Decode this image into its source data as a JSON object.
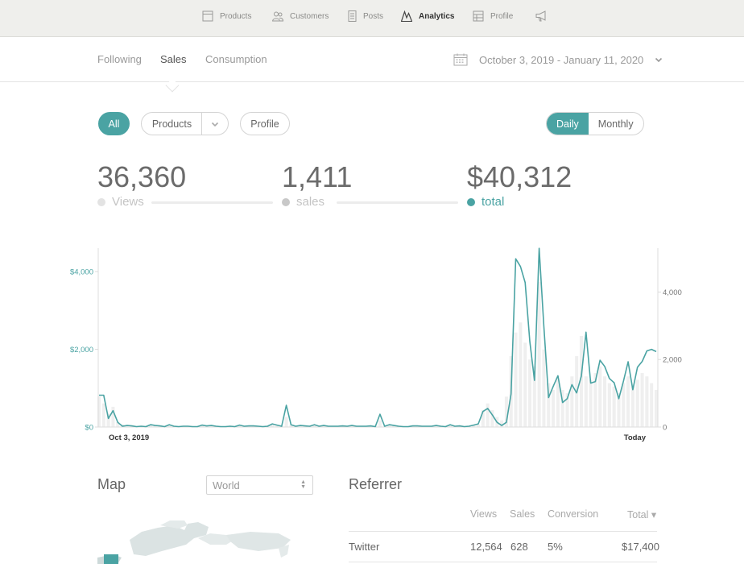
{
  "topnav": {
    "items": [
      {
        "label": "Products",
        "icon": "products-icon",
        "active": false
      },
      {
        "label": "Customers",
        "icon": "customers-icon",
        "active": false
      },
      {
        "label": "Posts",
        "icon": "posts-icon",
        "active": false
      },
      {
        "label": "Analytics",
        "icon": "analytics-icon",
        "active": true
      },
      {
        "label": "Profile",
        "icon": "profile-icon",
        "active": false
      },
      {
        "label": "",
        "icon": "megaphone-icon",
        "active": false
      }
    ]
  },
  "subheader": {
    "tabs": [
      {
        "label": "Following",
        "active": false
      },
      {
        "label": "Sales",
        "active": true
      },
      {
        "label": "Consumption",
        "active": false
      }
    ],
    "date_range": "October 3, 2019 - January 11, 2020"
  },
  "filters": {
    "all_label": "All",
    "products_label": "Products",
    "profile_label": "Profile",
    "granularity": {
      "daily": "Daily",
      "monthly": "Monthly",
      "selected": "Daily"
    }
  },
  "stats": {
    "views": {
      "value": "36,360",
      "label": "Views"
    },
    "sales": {
      "value": "1,411",
      "label": "sales"
    },
    "total": {
      "value": "$40,312",
      "label": "total"
    }
  },
  "colors": {
    "accent": "#4aa3a3",
    "bar_fill": "#efefef",
    "views_dot": "#e3e3e3",
    "sales_dot": "#c8c8c8"
  },
  "chart_data": {
    "type": "line",
    "x_start_label": "Oct 3, 2019",
    "x_end_label": "Today",
    "y_left_ticks": [
      "$0",
      "$2,000",
      "$4,000"
    ],
    "y_left_range": [
      0,
      4500
    ],
    "y_right_ticks": [
      "0",
      "2,000",
      "4,000"
    ],
    "y_right_range": [
      0,
      5300
    ],
    "series": [
      {
        "axis": "left",
        "style": "line",
        "values": [
          820,
          820,
          220,
          420,
          120,
          20,
          40,
          30,
          10,
          20,
          10,
          60,
          40,
          30,
          10,
          60,
          20,
          10,
          20,
          20,
          10,
          10,
          50,
          30,
          40,
          20,
          10,
          10,
          20,
          10,
          50,
          20,
          30,
          30,
          20,
          10,
          20,
          80,
          50,
          20,
          560,
          60,
          20,
          40,
          30,
          20,
          60,
          20,
          40,
          20,
          20,
          20,
          30,
          20,
          40,
          20,
          20,
          20,
          30,
          10,
          330,
          20,
          60,
          40,
          20,
          10,
          10,
          30,
          30,
          20,
          20,
          20,
          40,
          20,
          10,
          60,
          20,
          30,
          10,
          20,
          50,
          80,
          400,
          480,
          310,
          120,
          40,
          120,
          850,
          4330,
          4130,
          3720,
          2200,
          1200,
          4600,
          2600,
          760,
          1050,
          1320,
          630,
          730,
          1090,
          880,
          1310,
          2440,
          1130,
          1170,
          1720,
          1560,
          1250,
          1140,
          730,
          1180,
          1680,
          960,
          1540,
          1690,
          1960,
          2000,
          1940
        ],
        "values_note": ""
      },
      {
        "axis": "right",
        "style": "bar",
        "values": [
          900,
          700,
          400,
          600,
          150,
          80,
          60,
          40,
          20,
          30,
          20,
          50,
          40,
          30,
          20,
          40,
          30,
          20,
          30,
          20,
          20,
          20,
          40,
          30,
          30,
          20,
          20,
          20,
          20,
          20,
          40,
          20,
          30,
          30,
          20,
          20,
          20,
          60,
          40,
          20,
          300,
          60,
          20,
          40,
          30,
          20,
          40,
          20,
          30,
          20,
          20,
          20,
          30,
          20,
          30,
          20,
          20,
          20,
          30,
          20,
          200,
          30,
          50,
          40,
          30,
          20,
          20,
          30,
          30,
          20,
          20,
          20,
          30,
          20,
          20,
          40,
          20,
          30,
          20,
          20,
          50,
          70,
          500,
          700,
          500,
          300,
          200,
          900,
          2100,
          2800,
          3100,
          2500,
          2000,
          1800,
          4300,
          2300,
          1300,
          1100,
          1400,
          1100,
          1000,
          1500,
          2100,
          2700,
          1500,
          1400,
          1600,
          1800,
          1500,
          1300,
          1200,
          1000,
          1300,
          1500,
          1200,
          1400,
          1600,
          1500,
          1300,
          1100
        ]
      }
    ],
    "grid": false
  },
  "map": {
    "title": "Map",
    "region_select": "World"
  },
  "referrer": {
    "title": "Referrer",
    "headers": [
      "Views",
      "Sales",
      "Conversion",
      "Total ▾"
    ],
    "rows": [
      {
        "source": "Twitter",
        "views": "12,564",
        "sales": "628",
        "conversion": "5%",
        "total": "$17,400"
      }
    ]
  }
}
